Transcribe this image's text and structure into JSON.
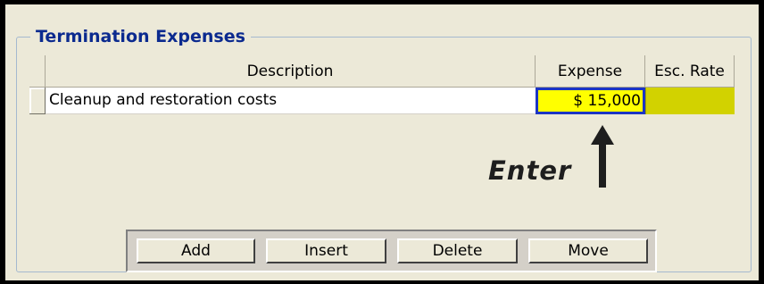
{
  "group_title": "Termination Expenses",
  "table": {
    "columns": [
      "Description",
      "Expense",
      "Esc. Rate"
    ],
    "rows": [
      {
        "description": "Cleanup and restoration costs",
        "expense": "$ 15,000",
        "esc_rate": ""
      }
    ]
  },
  "annotation": {
    "label": "Enter",
    "icon": "arrow-up-icon"
  },
  "buttons": {
    "add": "Add",
    "insert": "Insert",
    "delete": "Delete",
    "move": "Move"
  },
  "colors": {
    "selected_cell": "#ffff00",
    "selected_border": "#1c35c4",
    "esc_cell": "#d2d200",
    "group_title": "#0b2a8f"
  }
}
